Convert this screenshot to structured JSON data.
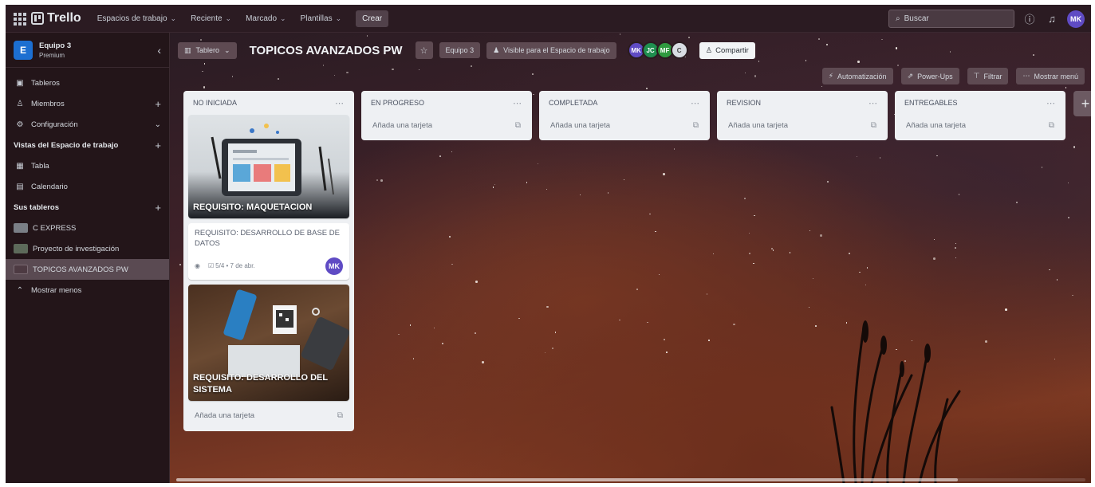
{
  "topbar": {
    "app_name": "Trello",
    "nav": [
      "Espacios de trabajo",
      "Reciente",
      "Marcado",
      "Plantillas"
    ],
    "create_label": "Crear",
    "search_placeholder": "Buscar",
    "user_initials": "MK"
  },
  "sidebar": {
    "workspace_name": "Equipo 3",
    "workspace_plan": "Premium",
    "workspace_initial": "E",
    "items": [
      {
        "label": "Tableros",
        "icon": "board-icon"
      },
      {
        "label": "Miembros",
        "icon": "member-icon"
      },
      {
        "label": "Configuración",
        "icon": "gear-icon"
      }
    ],
    "views_heading": "Vistas del Espacio de trabajo",
    "views": [
      {
        "label": "Tabla",
        "icon": "table-icon"
      },
      {
        "label": "Calendario",
        "icon": "calendar-icon"
      }
    ],
    "boards_heading": "Sus tableros",
    "boards": [
      {
        "label": "C EXPRESS",
        "color": "#7a7f86"
      },
      {
        "label": "Proyecto de investigación",
        "color": "#5d6a5a"
      },
      {
        "label": "TOPICOS AVANZADOS PW",
        "color": "#4d3a42"
      }
    ],
    "show_less": "Mostrar menos"
  },
  "board": {
    "view_label": "Tablero",
    "title": "TOPICOS AVANZADOS PW",
    "workspace_btn": "Equipo 3",
    "visibility_btn": "Visible para el Espacio de trabajo",
    "members": [
      {
        "initials": "MK",
        "color": "#5f4bc4"
      },
      {
        "initials": "JC",
        "color": "#1f8f4f"
      },
      {
        "initials": "MF",
        "color": "#2f9a3f"
      },
      {
        "initials": "C",
        "color": "#d9dde3"
      }
    ],
    "share_label": "Compartir",
    "actions": [
      "Automatización",
      "Power-Ups",
      "Filtrar",
      "Mostrar menú"
    ],
    "add_card_label": "Añada una tarjeta"
  },
  "lists": [
    {
      "title": "NO INICIADA",
      "cards": [
        {
          "cover_title": "REQUISITO: MAQUETACION"
        },
        {
          "title": "REQUISITO: DESARROLLO DE BASE DE DATOS",
          "checklist": "5/4 • 7 de abr.",
          "member": "MK"
        },
        {
          "cover_title": "REQUISITO: DESARROLLO DEL SISTEMA"
        }
      ]
    },
    {
      "title": "EN PROGRESO",
      "cards": []
    },
    {
      "title": "COMPLETADA",
      "cards": []
    },
    {
      "title": "REVISION",
      "cards": []
    },
    {
      "title": "ENTREGABLES",
      "cards": []
    }
  ],
  "colors": {
    "topbar": "#2b1b22",
    "sidebar": "#231519",
    "list_bg": "#eef0f3",
    "accent_avatar": "#5f4bc4"
  }
}
